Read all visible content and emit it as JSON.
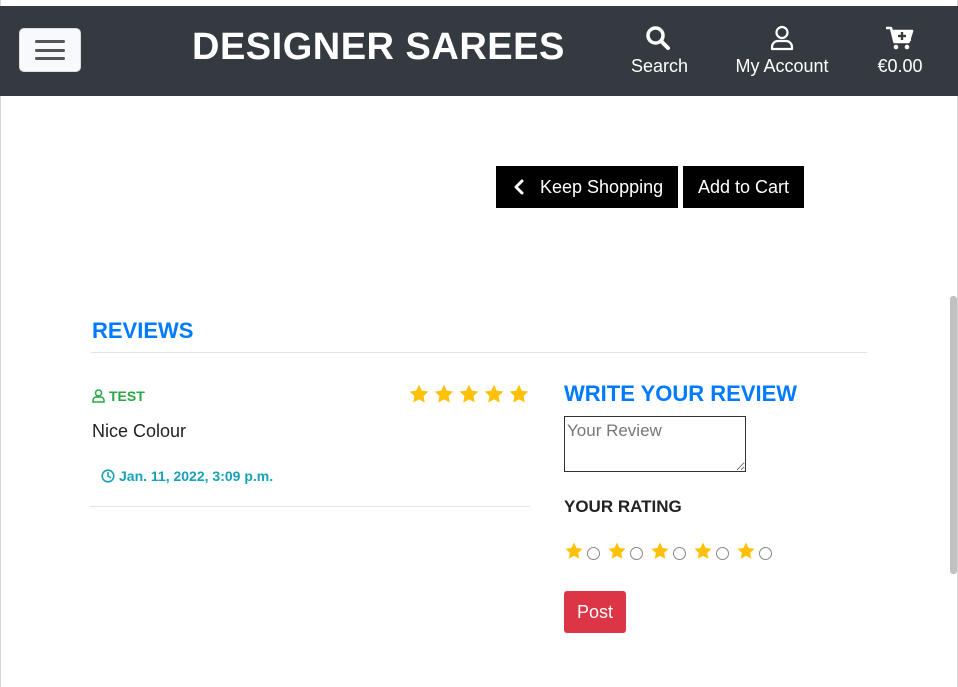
{
  "header": {
    "brand": "DESIGNER SAREES",
    "search_label": "Search",
    "account_label": "My Account",
    "cart_total": "€0.00"
  },
  "actions": {
    "keep_shopping": "Keep Shopping",
    "add_to_cart": "Add to Cart"
  },
  "reviews": {
    "title": "REVIEWS",
    "items": [
      {
        "user": "TEST",
        "rating": 5,
        "text": "Nice Colour",
        "date": "Jan. 11, 2022, 3:09 p.m."
      }
    ]
  },
  "write_review": {
    "title": "WRITE YOUR REVIEW",
    "placeholder": "Your Review",
    "rating_label": "YOUR RATING",
    "rating_options": [
      "star",
      "radio",
      "star",
      "radio",
      "star",
      "radio",
      "star",
      "radio",
      "star",
      "radio"
    ],
    "post_label": "Post"
  },
  "colors": {
    "header_bg": "#343a40",
    "accent_blue": "#007bff",
    "star_yellow": "#ffc107",
    "user_green": "#28a745",
    "date_teal": "#17a2b8",
    "post_red": "#dc3545"
  }
}
